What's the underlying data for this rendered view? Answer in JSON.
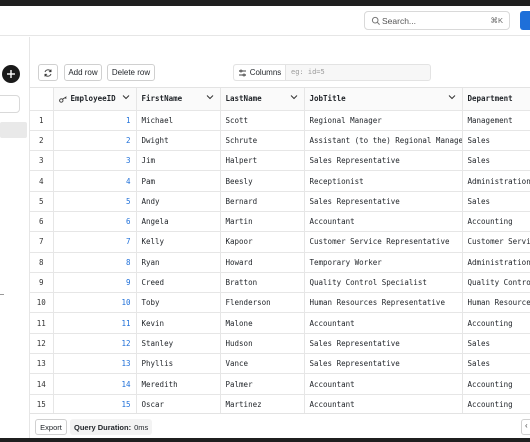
{
  "header": {
    "search_placeholder": "Search...",
    "search_shortcut": "⌘K"
  },
  "toolbar": {
    "add_row_label": "Add row",
    "delete_row_label": "Delete row",
    "columns_label": "Columns",
    "filter_placeholder": "eg: id=5"
  },
  "table": {
    "columns": [
      "EmployeeID",
      "FirstName",
      "LastName",
      "JobTitle",
      "Department"
    ],
    "rows": [
      {
        "n": "1",
        "id": "1",
        "first": "Michael",
        "last": "Scott",
        "title": "Regional Manager",
        "dept": "Management"
      },
      {
        "n": "2",
        "id": "2",
        "first": "Dwight",
        "last": "Schrute",
        "title": "Assistant (to the) Regional Manager",
        "dept": "Sales"
      },
      {
        "n": "3",
        "id": "3",
        "first": "Jim",
        "last": "Halpert",
        "title": "Sales Representative",
        "dept": "Sales"
      },
      {
        "n": "4",
        "id": "4",
        "first": "Pam",
        "last": "Beesly",
        "title": "Receptionist",
        "dept": "Administration"
      },
      {
        "n": "5",
        "id": "5",
        "first": "Andy",
        "last": "Bernard",
        "title": "Sales Representative",
        "dept": "Sales"
      },
      {
        "n": "6",
        "id": "6",
        "first": "Angela",
        "last": "Martin",
        "title": "Accountant",
        "dept": "Accounting"
      },
      {
        "n": "7",
        "id": "7",
        "first": "Kelly",
        "last": "Kapoor",
        "title": "Customer Service Representative",
        "dept": "Customer Service"
      },
      {
        "n": "8",
        "id": "8",
        "first": "Ryan",
        "last": "Howard",
        "title": "Temporary Worker",
        "dept": "Administration"
      },
      {
        "n": "9",
        "id": "9",
        "first": "Creed",
        "last": "Bratton",
        "title": "Quality Control Specialist",
        "dept": "Quality Control"
      },
      {
        "n": "10",
        "id": "10",
        "first": "Toby",
        "last": "Flenderson",
        "title": "Human Resources Representative",
        "dept": "Human Resources"
      },
      {
        "n": "11",
        "id": "11",
        "first": "Kevin",
        "last": "Malone",
        "title": "Accountant",
        "dept": "Accounting"
      },
      {
        "n": "12",
        "id": "12",
        "first": "Stanley",
        "last": "Hudson",
        "title": "Sales Representative",
        "dept": "Sales"
      },
      {
        "n": "13",
        "id": "13",
        "first": "Phyllis",
        "last": "Vance",
        "title": "Sales Representative",
        "dept": "Sales"
      },
      {
        "n": "14",
        "id": "14",
        "first": "Meredith",
        "last": "Palmer",
        "title": "Accountant",
        "dept": "Accounting"
      },
      {
        "n": "15",
        "id": "15",
        "first": "Oscar",
        "last": "Martinez",
        "title": "Accountant",
        "dept": "Accounting"
      }
    ]
  },
  "footer": {
    "export_label": "Export",
    "query_duration_label": "Query Duration:",
    "query_duration_value": "0ms"
  },
  "icons": [
    "search-icon",
    "plus-icon",
    "refresh-icon",
    "columns-icon",
    "key-icon",
    "chevron-down-icon",
    "chevron-left-icon"
  ],
  "colors": {
    "accent": "#1e6fd9",
    "dark": "#1a1a1a"
  }
}
